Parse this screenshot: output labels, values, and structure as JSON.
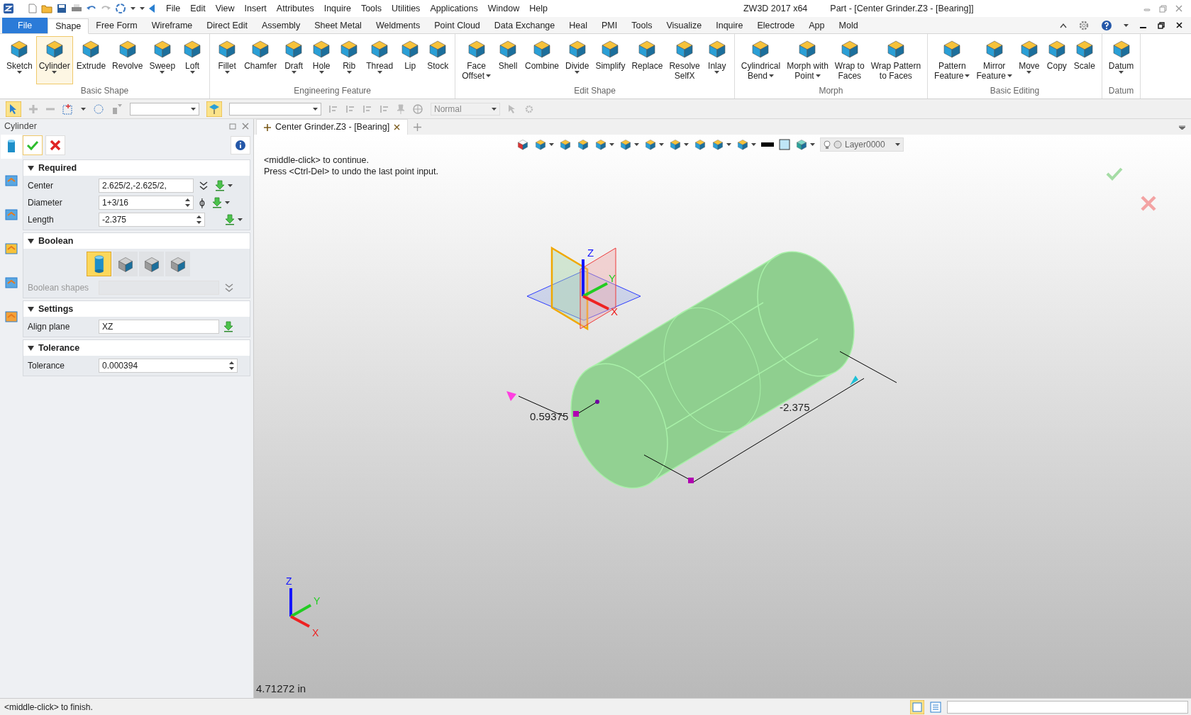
{
  "title_bar": {
    "menus": [
      "File",
      "Edit",
      "View",
      "Insert",
      "Attributes",
      "Inquire",
      "Tools",
      "Utilities",
      "Applications",
      "Window",
      "Help"
    ],
    "app": "ZW3D 2017  x64",
    "document": "Part - [Center Grinder.Z3 - [Bearing]]"
  },
  "ribbon_tabs": [
    {
      "label": "File",
      "kind": "file",
      "selected": false
    },
    {
      "label": "Shape",
      "kind": "tab",
      "selected": true
    },
    {
      "label": "Free Form",
      "kind": "tab",
      "selected": false
    },
    {
      "label": "Wireframe",
      "kind": "tab",
      "selected": false
    },
    {
      "label": "Direct Edit",
      "kind": "tab",
      "selected": false
    },
    {
      "label": "Assembly",
      "kind": "tab",
      "selected": false
    },
    {
      "label": "Sheet Metal",
      "kind": "tab",
      "selected": false
    },
    {
      "label": "Weldments",
      "kind": "tab",
      "selected": false
    },
    {
      "label": "Point Cloud",
      "kind": "tab",
      "selected": false
    },
    {
      "label": "Data Exchange",
      "kind": "tab",
      "selected": false
    },
    {
      "label": "Heal",
      "kind": "tab",
      "selected": false
    },
    {
      "label": "PMI",
      "kind": "tab",
      "selected": false
    },
    {
      "label": "Tools",
      "kind": "tab",
      "selected": false
    },
    {
      "label": "Visualize",
      "kind": "tab",
      "selected": false
    },
    {
      "label": "Inquire",
      "kind": "tab",
      "selected": false
    },
    {
      "label": "Electrode",
      "kind": "tab",
      "selected": false
    },
    {
      "label": "App",
      "kind": "tab",
      "selected": false
    },
    {
      "label": "Mold",
      "kind": "tab",
      "selected": false
    }
  ],
  "ribbon_groups": [
    {
      "label": "Basic Shape",
      "tools": [
        {
          "label": "Sketch",
          "dropdown": true,
          "selected": false
        },
        {
          "label": "Cylinder",
          "dropdown": true,
          "selected": true
        },
        {
          "label": "Extrude",
          "dropdown": false,
          "selected": false
        },
        {
          "label": "Revolve",
          "dropdown": false,
          "selected": false
        },
        {
          "label": "Sweep",
          "dropdown": true,
          "selected": false
        },
        {
          "label": "Loft",
          "dropdown": true,
          "selected": false
        }
      ]
    },
    {
      "label": "Engineering Feature",
      "tools": [
        {
          "label": "Fillet",
          "dropdown": true,
          "selected": false
        },
        {
          "label": "Chamfer",
          "dropdown": false,
          "selected": false
        },
        {
          "label": "Draft",
          "dropdown": true,
          "selected": false
        },
        {
          "label": "Hole",
          "dropdown": true,
          "selected": false
        },
        {
          "label": "Rib",
          "dropdown": true,
          "selected": false
        },
        {
          "label": "Thread",
          "dropdown": true,
          "selected": false
        },
        {
          "label": "Lip",
          "dropdown": false,
          "selected": false
        },
        {
          "label": "Stock",
          "dropdown": false,
          "selected": false
        }
      ]
    },
    {
      "label": "Edit Shape",
      "tools": [
        {
          "label": "Face\nOffset",
          "dropdown": true,
          "selected": false
        },
        {
          "label": "Shell",
          "dropdown": false,
          "selected": false
        },
        {
          "label": "Combine",
          "dropdown": false,
          "selected": false
        },
        {
          "label": "Divide",
          "dropdown": true,
          "selected": false
        },
        {
          "label": "Simplify",
          "dropdown": false,
          "selected": false
        },
        {
          "label": "Replace",
          "dropdown": false,
          "selected": false
        },
        {
          "label": "Resolve\nSelfX",
          "dropdown": false,
          "selected": false
        },
        {
          "label": "Inlay",
          "dropdown": true,
          "selected": false
        }
      ]
    },
    {
      "label": "Morph",
      "tools": [
        {
          "label": "Cylindrical\nBend",
          "dropdown": true,
          "selected": false
        },
        {
          "label": "Morph with\nPoint",
          "dropdown": true,
          "selected": false
        },
        {
          "label": "Wrap to\nFaces",
          "dropdown": false,
          "selected": false
        },
        {
          "label": "Wrap Pattern\nto Faces",
          "dropdown": false,
          "selected": false
        }
      ]
    },
    {
      "label": "Basic Editing",
      "tools": [
        {
          "label": "Pattern\nFeature",
          "dropdown": true,
          "selected": false
        },
        {
          "label": "Mirror\nFeature",
          "dropdown": true,
          "selected": false
        },
        {
          "label": "Move",
          "dropdown": true,
          "selected": false
        },
        {
          "label": "Copy",
          "dropdown": false,
          "selected": false
        },
        {
          "label": "Scale",
          "dropdown": false,
          "selected": false
        }
      ]
    },
    {
      "label": "Datum",
      "tools": [
        {
          "label": "Datum",
          "dropdown": true,
          "selected": false
        }
      ]
    }
  ],
  "toolbar": {
    "view_mode": "Normal"
  },
  "panel": {
    "title": "Cylinder",
    "side_tabs": [
      {
        "selected": true
      },
      {
        "selected": false
      },
      {
        "selected": false
      },
      {
        "selected": false
      },
      {
        "selected": false
      },
      {
        "selected": false
      }
    ],
    "sections": [
      {
        "title": "Required",
        "kind": "fields",
        "expanded": true,
        "fields": [
          {
            "label": "Center",
            "value": "2.625/2,-2.625/2,",
            "kind": "text",
            "more_button": true
          },
          {
            "label": "Diameter",
            "value": "1+3/16",
            "kind": "spin",
            "symbol": "ϕ"
          },
          {
            "label": "Length",
            "value": "-2.375",
            "kind": "spin"
          }
        ]
      },
      {
        "title": "Boolean",
        "kind": "boolean",
        "expanded": true,
        "options": [
          {
            "selected": true
          },
          {
            "selected": false
          },
          {
            "selected": false
          },
          {
            "selected": false
          }
        ],
        "shapes_label": "Boolean shapes",
        "disabled": true
      },
      {
        "title": "Settings",
        "kind": "fields",
        "expanded": true,
        "fields": [
          {
            "label": "Align plane",
            "value": "XZ",
            "kind": "plain"
          }
        ]
      },
      {
        "title": "Tolerance",
        "kind": "fields",
        "expanded": true,
        "fields": [
          {
            "label": "Tolerance",
            "value": "0.000394",
            "kind": "spinwide"
          }
        ]
      }
    ]
  },
  "document_tab": {
    "label": "Center Grinder.Z3 - [Bearing]"
  },
  "layer": "Layer0000",
  "prompts": [
    "<middle-click> to continue.",
    "Press <Ctrl-Del> to undo the last point input."
  ],
  "viewport": {
    "dimension_diameter": "0.59375",
    "dimension_length": "-2.375",
    "triad_labels": [
      "Z",
      "Y",
      "X"
    ],
    "corner_triad_labels": [
      "Z",
      "Y",
      "X"
    ],
    "scale_readout": "4.71272 in"
  },
  "status_bar": {
    "message": "<middle-click> to finish."
  }
}
